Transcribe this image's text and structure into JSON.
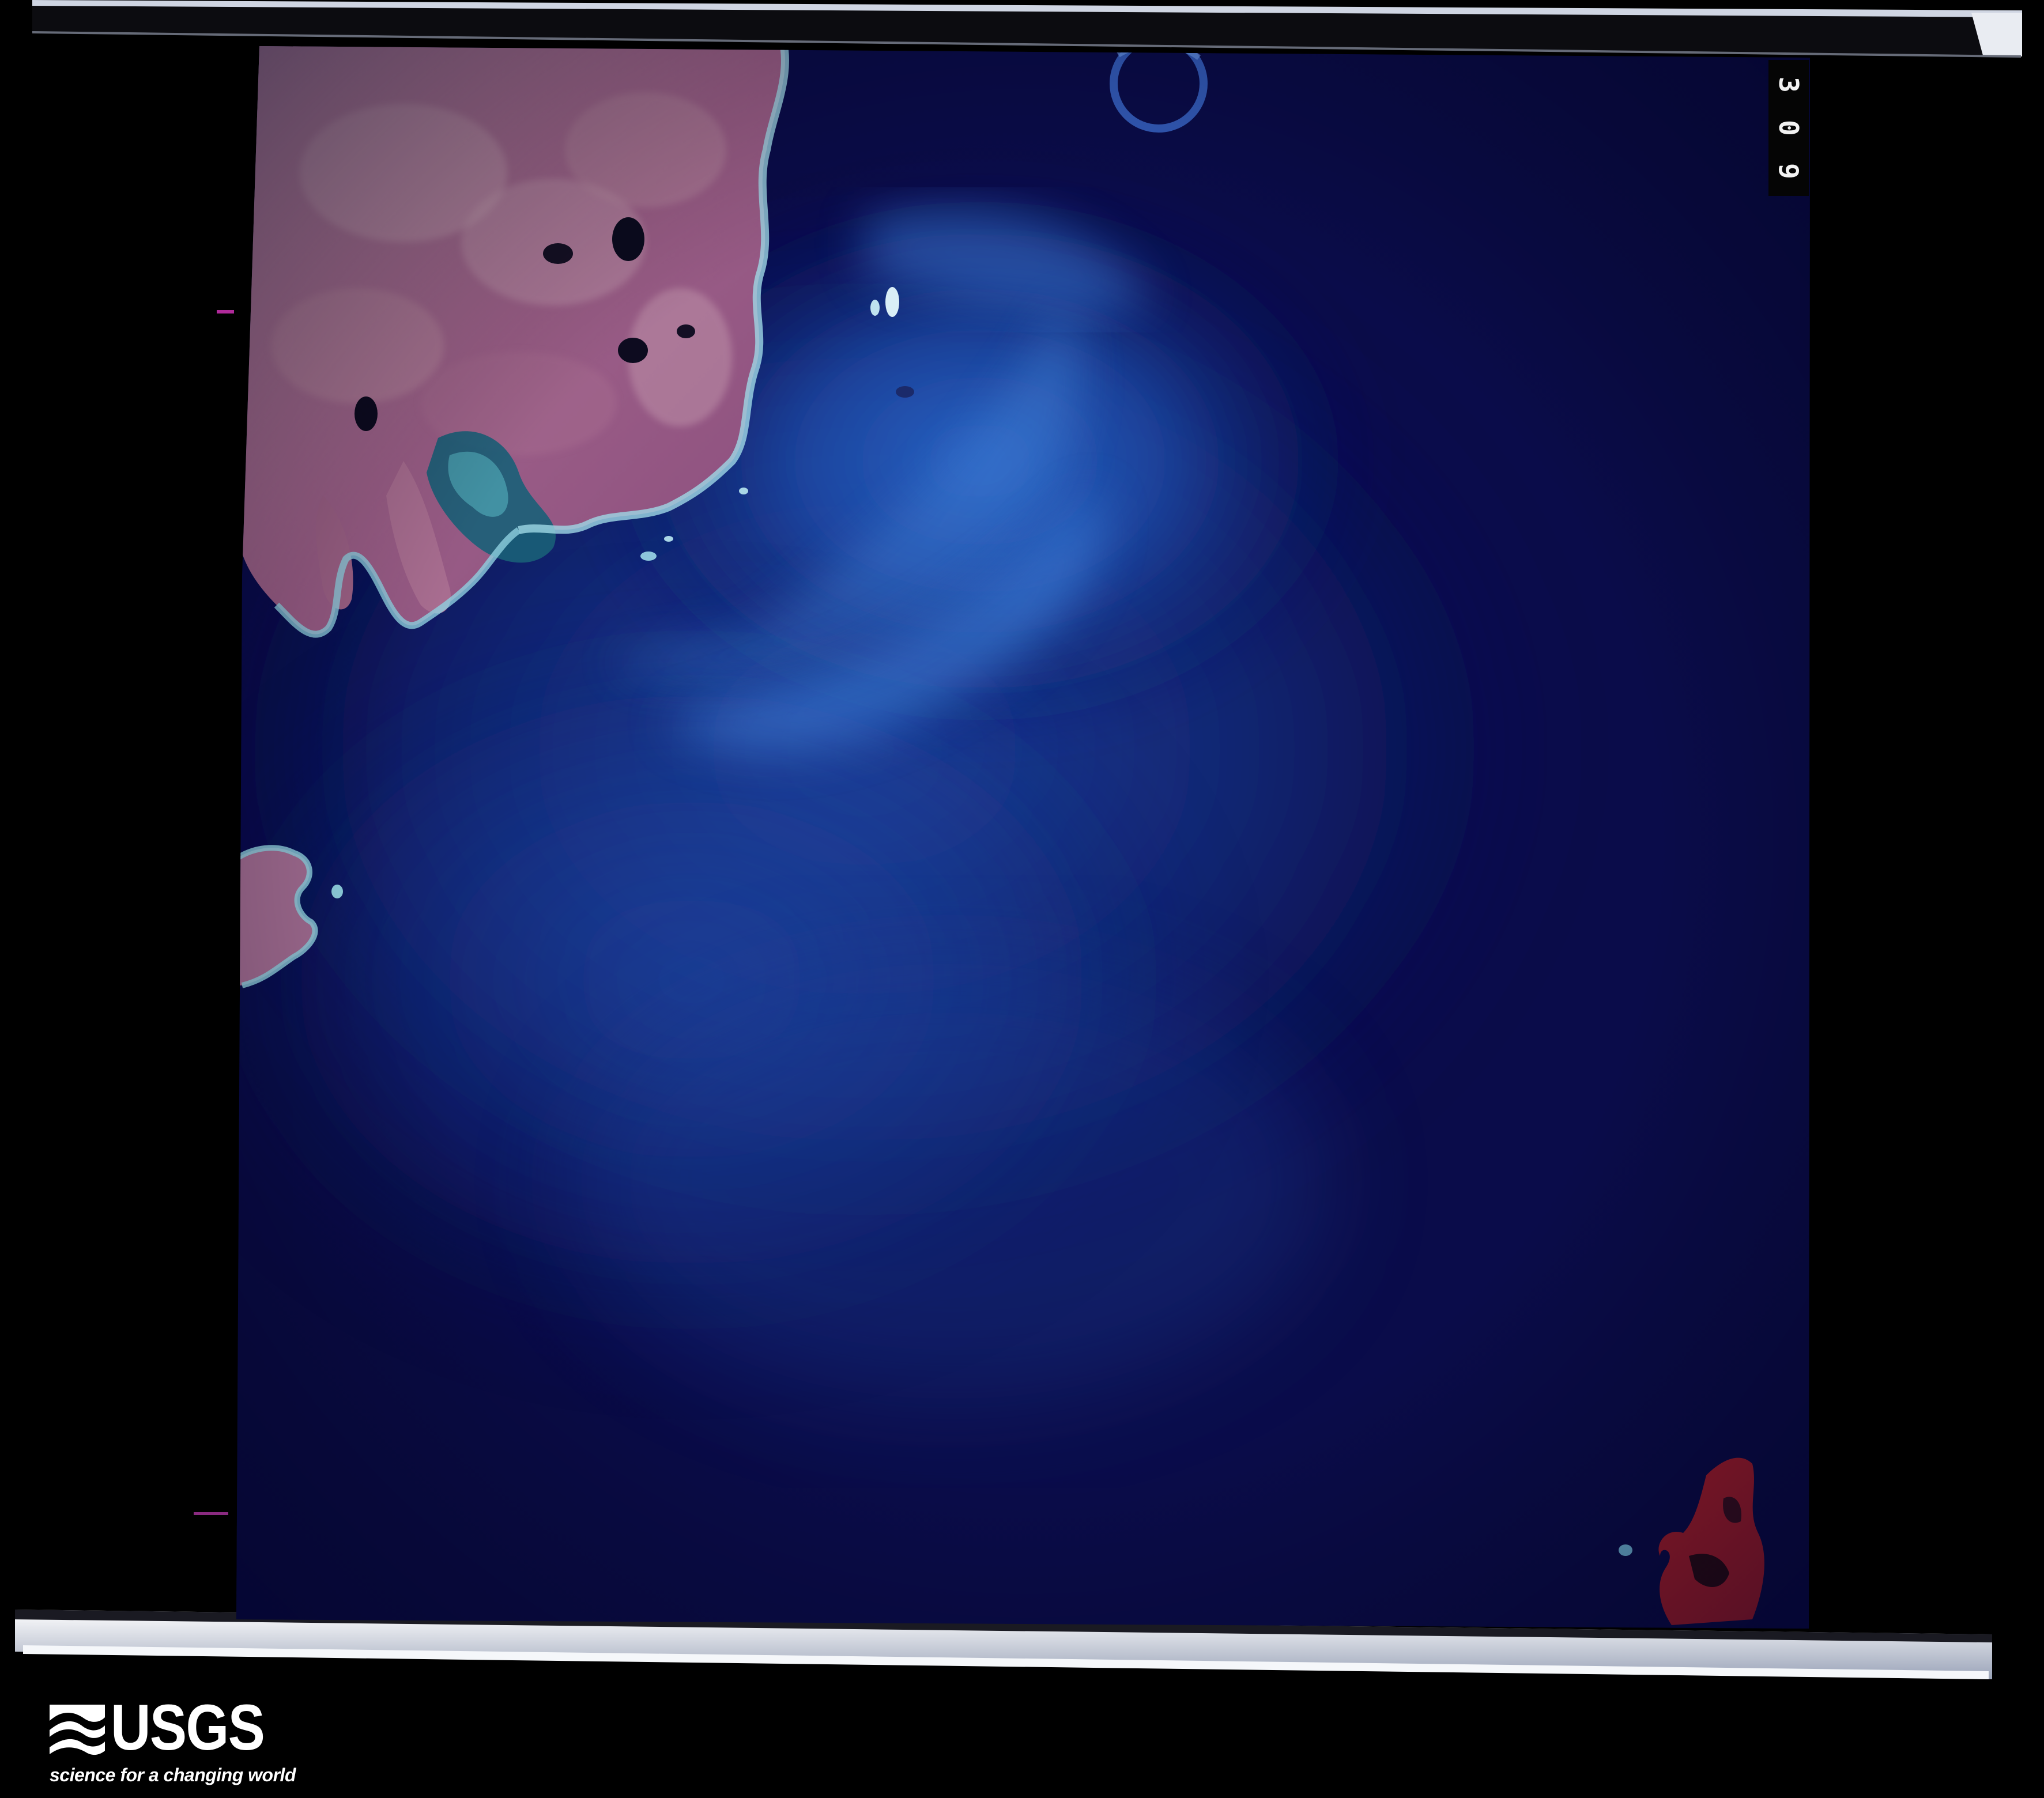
{
  "photo": {
    "frame_number": "309",
    "frame_number_digits": [
      "3",
      "0",
      "9"
    ]
  },
  "logo": {
    "name": "USGS",
    "tagline": "science for a changing world"
  },
  "colors": {
    "background": "#000000",
    "ocean_deep": "#0a0c4a",
    "ocean_shallow": "#2f6fd0",
    "land_false_color": "#9a5f86",
    "reef_cyan": "#7fc8de",
    "island_red": "#a51e2e"
  }
}
